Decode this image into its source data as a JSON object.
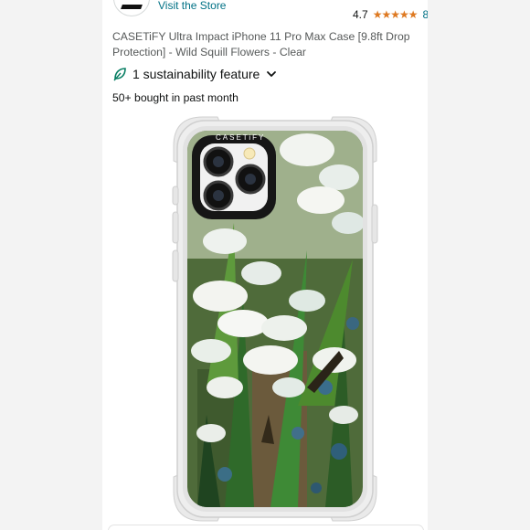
{
  "store": {
    "link_text": "Visit the Store",
    "icon": "brand-logo"
  },
  "rating": {
    "value": "4.7",
    "stars_filled": 4.5,
    "stars_text": "★★★★★",
    "count_partial": "8"
  },
  "product": {
    "title": "CASETiFY Ultra Impact iPhone 11 Pro Max Case [9.8ft Drop Protection] - Wild Squill Flowers - Clear",
    "brand_text_on_case": "CASETiFY",
    "image_description": "clear case with painted white flowers and green stems"
  },
  "sustainability": {
    "label": "1 sustainability feature",
    "icon": "leaf-icon",
    "chevron": "chevron-down-icon"
  },
  "purchase_info": {
    "bought_text": "50+ bought in past month"
  },
  "colors": {
    "link": "#007185",
    "star": "#de7921",
    "leaf": "#067d62",
    "text": "#0f1111",
    "muted": "#565959"
  }
}
